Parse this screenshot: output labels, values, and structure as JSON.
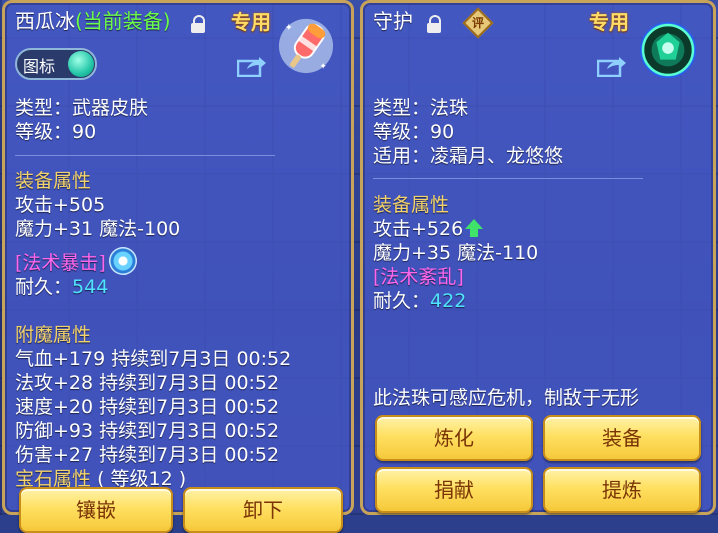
{
  "left": {
    "item_name": "西瓜冰",
    "equip_status": "(当前装备)",
    "exclusive": "专用",
    "toggle_label": "图标",
    "type_line": "类型：武器皮肤",
    "level_line": "等级：90",
    "equip_attr_header": "装备属性",
    "attack_line": "攻击+505",
    "magic_line": "魔力+31 魔法-100",
    "special_skill": "[法术暴击]",
    "durability_label": "耐久：",
    "durability_value": "544",
    "enchant_header": "附魔属性",
    "enchant_lines": [
      "气血+179 持续到7月3日 00:52",
      "法攻+28 持续到7月3日 00:52",
      "速度+20 持续到7月3日 00:52",
      "防御+93 持续到7月3日 00:52",
      "伤害+27 持续到7月3日 00:52"
    ],
    "gem_header": "宝石属性",
    "gem_level": "( 等级12 )",
    "buttons": [
      "镶嵌",
      "卸下"
    ]
  },
  "right": {
    "item_name": "守护",
    "eval_badge": "评",
    "exclusive": "专用",
    "type_line": "类型：法珠",
    "level_line": "等级：90",
    "suits_line": "适用：凌霜月、龙悠悠",
    "equip_attr_header": "装备属性",
    "attack_line": "攻击+526",
    "magic_line": "魔力+35 魔法-110",
    "special_skill": "[法术紊乱]",
    "durability_label": "耐久：",
    "durability_value": "422",
    "description": "此法珠可感应危机，制敌于无形",
    "buttons": [
      "炼化",
      "装备",
      "捐献",
      "提炼"
    ]
  },
  "colors": {
    "panel_bg": "#4a5ac8",
    "border_gold": "#c8a45a",
    "header_gold": "#f3d36a",
    "status_green": "#6cff4a",
    "skill_pink": "#ff66ee",
    "durability_cyan": "#4fe3ff",
    "button_yellow": "#ffe061"
  },
  "icons": [
    "lock-icon",
    "share-icon",
    "popsicle-weapon-icon",
    "eval-badge-icon",
    "orb-icon",
    "up-arrow-icon",
    "swirl-skill-icon"
  ]
}
